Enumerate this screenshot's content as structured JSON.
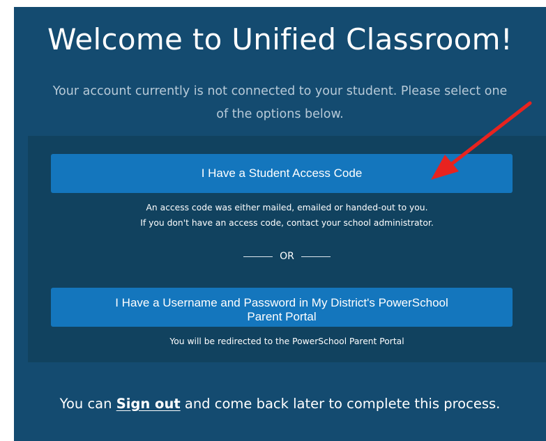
{
  "welcome": {
    "title": "Welcome to Unified Classroom!",
    "subtitle_line1": "Your account currently is not connected to your student. Please select one",
    "subtitle_line2": "of the options below."
  },
  "options": {
    "access_code_button": "I Have a Student Access Code",
    "access_code_note_line1": "An access code was either mailed, emailed or handed-out to you.",
    "access_code_note_line2": "If you don't have an access code, contact your school administrator.",
    "separator": "OR",
    "portal_button_line1": "I Have a Username and Password in My District's PowerSchool",
    "portal_button_line2": "Parent Portal",
    "portal_note": "You will be redirected to the PowerSchool Parent Portal"
  },
  "footer": {
    "prefix": "You can ",
    "sign_out_link": "Sign out",
    "suffix": " and come back later to complete this process."
  },
  "colors": {
    "background": "#144b70",
    "panel": "#11425f",
    "button": "#1476bd",
    "annotation_arrow": "#e8231f"
  }
}
